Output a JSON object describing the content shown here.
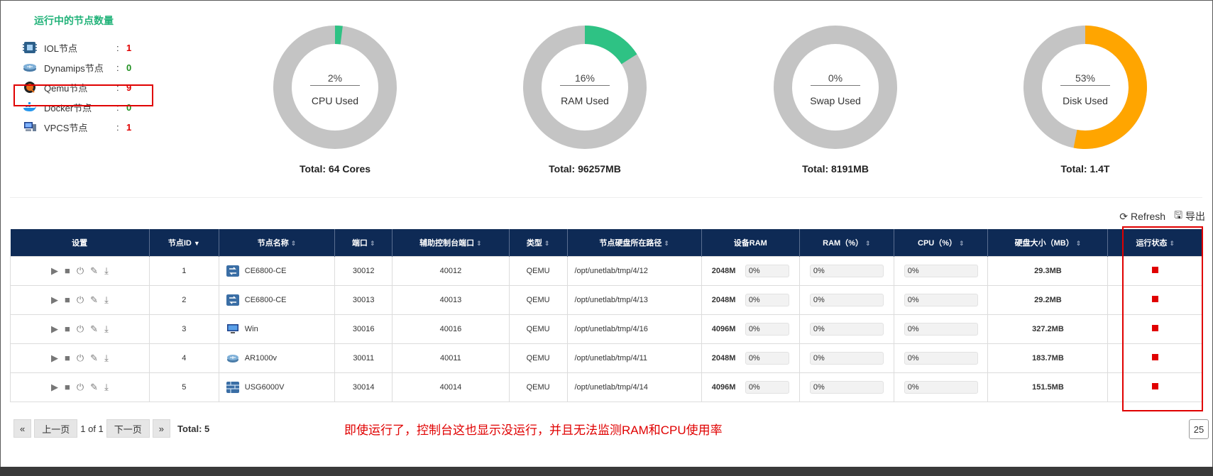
{
  "nodes_panel": {
    "title": "运行中的节点数量",
    "items": [
      {
        "name": "IOL节点",
        "colon": ":",
        "count": "1"
      },
      {
        "name": "Dynamips节点",
        "colon": ":",
        "count": "0"
      },
      {
        "name": "Qemu节点",
        "colon": ":",
        "count": "9"
      },
      {
        "name": "Docker节点",
        "colon": ":",
        "count": "0"
      },
      {
        "name": "VPCS节点",
        "colon": ":",
        "count": "1"
      }
    ]
  },
  "gauges": [
    {
      "percent": "2%",
      "value": 2,
      "label": "CPU Used",
      "total": "Total: 64 Cores",
      "color": "#2ec284"
    },
    {
      "percent": "16%",
      "value": 16,
      "label": "RAM Used",
      "total": "Total: 96257MB",
      "color": "#2ec284"
    },
    {
      "percent": "0%",
      "value": 0,
      "label": "Swap Used",
      "total": "Total: 8191MB",
      "color": "#2ec284"
    },
    {
      "percent": "53%",
      "value": 53,
      "label": "Disk Used",
      "total": "Total: 1.4T",
      "color": "#ffa500"
    }
  ],
  "colors": {
    "track": "#c4c4c4",
    "header_bg": "#0e2a55",
    "alert": "#e00000"
  },
  "toolbar": {
    "refresh": "Refresh",
    "export": "导出"
  },
  "table": {
    "headers": [
      "设置",
      "节点ID",
      "节点名称",
      "端口",
      "辅助控制台端口",
      "类型",
      "节点硬盘所在路径",
      "设备RAM",
      "RAM（%）",
      "CPU（%）",
      "硬盘大小（MB）",
      "运行状态"
    ],
    "rows": [
      {
        "id": "1",
        "name": "CE6800-CE",
        "icon": "switch-icon",
        "port": "30012",
        "aux": "40012",
        "type": "QEMU",
        "path": "/opt/unetlab/tmp/4/12",
        "ram": "2048M",
        "ram_usage": "0%",
        "ram_pct": "0%",
        "cpu_pct": "0%",
        "disk": "29.3MB"
      },
      {
        "id": "2",
        "name": "CE6800-CE",
        "icon": "switch-icon",
        "port": "30013",
        "aux": "40013",
        "type": "QEMU",
        "path": "/opt/unetlab/tmp/4/13",
        "ram": "2048M",
        "ram_usage": "0%",
        "ram_pct": "0%",
        "cpu_pct": "0%",
        "disk": "29.2MB"
      },
      {
        "id": "3",
        "name": "Win",
        "icon": "monitor-icon",
        "port": "30016",
        "aux": "40016",
        "type": "QEMU",
        "path": "/opt/unetlab/tmp/4/16",
        "ram": "4096M",
        "ram_usage": "0%",
        "ram_pct": "0%",
        "cpu_pct": "0%",
        "disk": "327.2MB"
      },
      {
        "id": "4",
        "name": "AR1000v",
        "icon": "router-icon",
        "port": "30011",
        "aux": "40011",
        "type": "QEMU",
        "path": "/opt/unetlab/tmp/4/11",
        "ram": "2048M",
        "ram_usage": "0%",
        "ram_pct": "0%",
        "cpu_pct": "0%",
        "disk": "183.7MB"
      },
      {
        "id": "5",
        "name": "USG6000V",
        "icon": "firewall-icon",
        "port": "30014",
        "aux": "40014",
        "type": "QEMU",
        "path": "/opt/unetlab/tmp/4/14",
        "ram": "4096M",
        "ram_usage": "0%",
        "ram_pct": "0%",
        "cpu_pct": "0%",
        "disk": "151.5MB"
      }
    ]
  },
  "pagination": {
    "first": "«",
    "prev": "上一页",
    "info": "1 of 1",
    "next": "下一页",
    "last": "»",
    "total": "Total: 5",
    "per_page": "25"
  },
  "annotation": "即使运行了，控制台这也显示没运行，并且无法监测RAM和CPU使用率"
}
